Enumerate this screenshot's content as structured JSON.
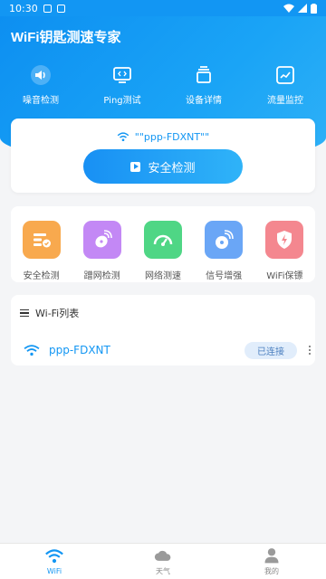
{
  "status": {
    "time": "10:30"
  },
  "app": {
    "title": "WiFi钥匙测速专家"
  },
  "tools": [
    {
      "label": "噪音检测",
      "icon": "speaker-icon"
    },
    {
      "label": "Ping测试",
      "icon": "monitor-code-icon"
    },
    {
      "label": "设备详情",
      "icon": "stack-icon"
    },
    {
      "label": "流量监控",
      "icon": "chart-icon"
    }
  ],
  "connection": {
    "ssid": "\"\"ppp-FDXNT\"\"",
    "scan_label": "安全检测"
  },
  "features": [
    {
      "label": "安全检测",
      "icon": "security-scan-icon",
      "color": "#f8a94e"
    },
    {
      "label": "蹭网检测",
      "icon": "satellite-icon",
      "color": "#c388f5"
    },
    {
      "label": "网络测速",
      "icon": "speedometer-icon",
      "color": "#4fd685"
    },
    {
      "label": "信号增强",
      "icon": "signal-boost-icon",
      "color": "#6aa6f6"
    },
    {
      "label": "WiFi保镖",
      "icon": "shield-icon",
      "color": "#f4878f"
    }
  ],
  "wifi_list": {
    "title": "Wi-Fi列表",
    "networks": [
      {
        "ssid": "ppp-FDXNT",
        "status": "已连接"
      }
    ]
  },
  "nav": [
    {
      "label": "WiFi",
      "icon": "wifi-icon",
      "active": true
    },
    {
      "label": "天气",
      "icon": "cloud-icon",
      "active": false
    },
    {
      "label": "我的",
      "icon": "person-icon",
      "active": false
    }
  ],
  "colors": {
    "primary": "#1296f3",
    "background": "#f4f5f7"
  }
}
